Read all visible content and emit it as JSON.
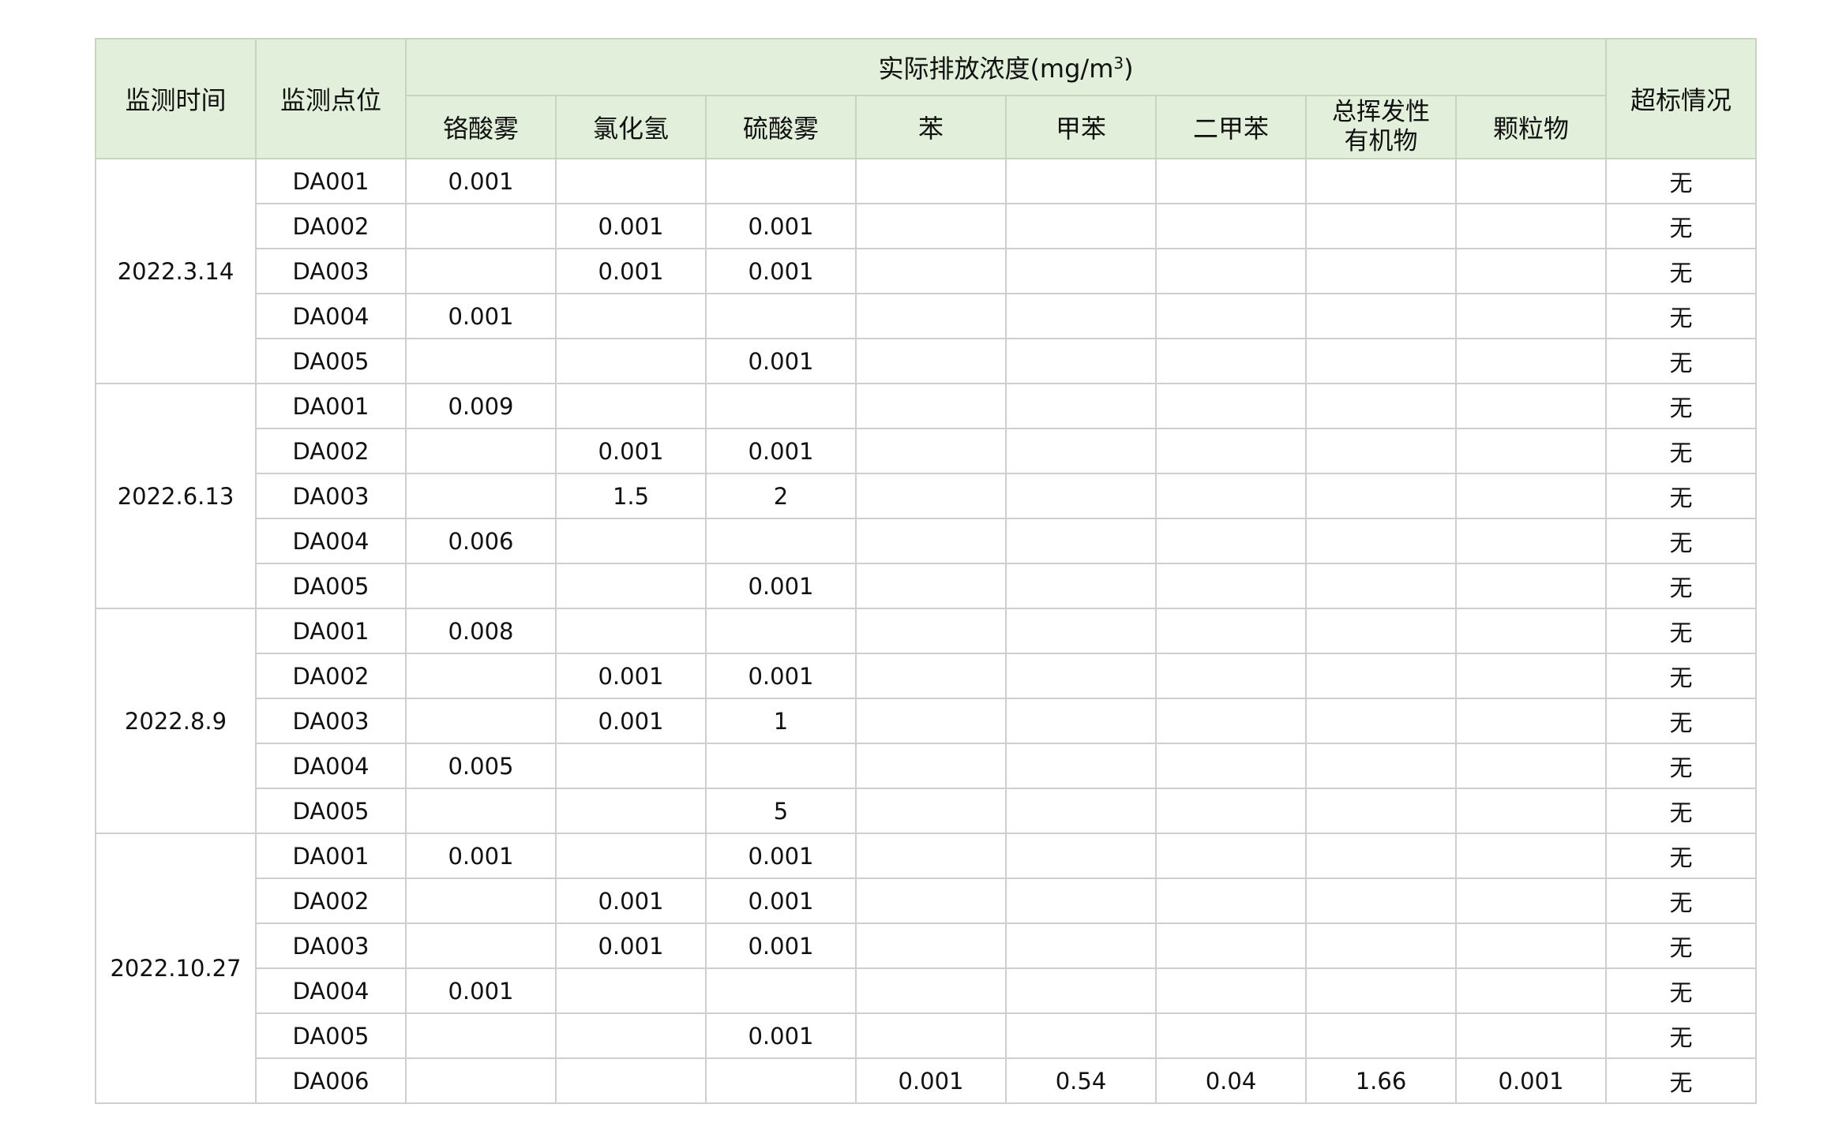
{
  "headers": {
    "time": "监测时间",
    "point": "监测点位",
    "concentration_prefix": "实际排放浓度(mg/m",
    "concentration_sup": "3",
    "concentration_suffix": ")",
    "exceed": "超标情况",
    "pollutants": [
      "铬酸雾",
      "氯化氢",
      "硫酸雾",
      "苯",
      "甲苯",
      "二甲苯",
      "总挥发性有机物",
      "颗粒物"
    ]
  },
  "groups": [
    {
      "date": "2022.3.14",
      "rows": [
        {
          "point": "DA001",
          "values": [
            "0.001",
            "",
            "",
            "",
            "",
            "",
            "",
            ""
          ],
          "exceed": "无"
        },
        {
          "point": "DA002",
          "values": [
            "",
            "0.001",
            "0.001",
            "",
            "",
            "",
            "",
            ""
          ],
          "exceed": "无"
        },
        {
          "point": "DA003",
          "values": [
            "",
            "0.001",
            "0.001",
            "",
            "",
            "",
            "",
            ""
          ],
          "exceed": "无"
        },
        {
          "point": "DA004",
          "values": [
            "0.001",
            "",
            "",
            "",
            "",
            "",
            "",
            ""
          ],
          "exceed": "无"
        },
        {
          "point": "DA005",
          "values": [
            "",
            "",
            "0.001",
            "",
            "",
            "",
            "",
            ""
          ],
          "exceed": "无"
        }
      ]
    },
    {
      "date": "2022.6.13",
      "rows": [
        {
          "point": "DA001",
          "values": [
            "0.009",
            "",
            "",
            "",
            "",
            "",
            "",
            ""
          ],
          "exceed": "无"
        },
        {
          "point": "DA002",
          "values": [
            "",
            "0.001",
            "0.001",
            "",
            "",
            "",
            "",
            ""
          ],
          "exceed": "无"
        },
        {
          "point": "DA003",
          "values": [
            "",
            "1.5",
            "2",
            "",
            "",
            "",
            "",
            ""
          ],
          "exceed": "无"
        },
        {
          "point": "DA004",
          "values": [
            "0.006",
            "",
            "",
            "",
            "",
            "",
            "",
            ""
          ],
          "exceed": "无"
        },
        {
          "point": "DA005",
          "values": [
            "",
            "",
            "0.001",
            "",
            "",
            "",
            "",
            ""
          ],
          "exceed": "无"
        }
      ]
    },
    {
      "date": "2022.8.9",
      "rows": [
        {
          "point": "DA001",
          "values": [
            "0.008",
            "",
            "",
            "",
            "",
            "",
            "",
            ""
          ],
          "exceed": "无"
        },
        {
          "point": "DA002",
          "values": [
            "",
            "0.001",
            "0.001",
            "",
            "",
            "",
            "",
            ""
          ],
          "exceed": "无"
        },
        {
          "point": "DA003",
          "values": [
            "",
            "0.001",
            "1",
            "",
            "",
            "",
            "",
            ""
          ],
          "exceed": "无"
        },
        {
          "point": "DA004",
          "values": [
            "0.005",
            "",
            "",
            "",
            "",
            "",
            "",
            ""
          ],
          "exceed": "无"
        },
        {
          "point": "DA005",
          "values": [
            "",
            "",
            "5",
            "",
            "",
            "",
            "",
            ""
          ],
          "exceed": "无"
        }
      ]
    },
    {
      "date": "2022.10.27",
      "rows": [
        {
          "point": "DA001",
          "values": [
            "0.001",
            "",
            "0.001",
            "",
            "",
            "",
            "",
            ""
          ],
          "exceed": "无"
        },
        {
          "point": "DA002",
          "values": [
            "",
            "0.001",
            "0.001",
            "",
            "",
            "",
            "",
            ""
          ],
          "exceed": "无"
        },
        {
          "point": "DA003",
          "values": [
            "",
            "0.001",
            "0.001",
            "",
            "",
            "",
            "",
            ""
          ],
          "exceed": "无"
        },
        {
          "point": "DA004",
          "values": [
            "0.001",
            "",
            "",
            "",
            "",
            "",
            "",
            ""
          ],
          "exceed": "无"
        },
        {
          "point": "DA005",
          "values": [
            "",
            "",
            "0.001",
            "",
            "",
            "",
            "",
            ""
          ],
          "exceed": "无"
        },
        {
          "point": "DA006",
          "values": [
            "",
            "",
            "",
            "0.001",
            "0.54",
            "0.04",
            "1.66",
            "0.001"
          ],
          "exceed": "无"
        }
      ]
    }
  ]
}
